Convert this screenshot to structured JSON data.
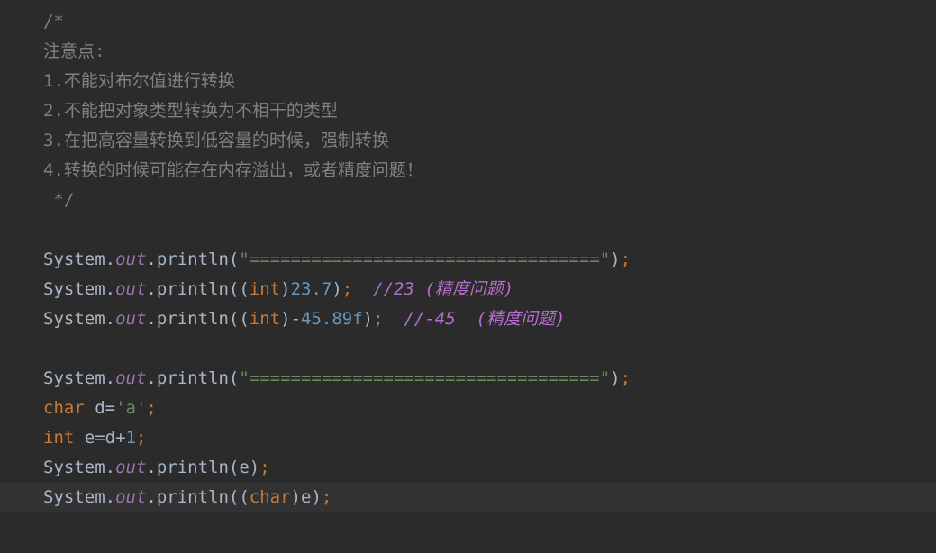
{
  "editor": {
    "language": "java",
    "colors": {
      "background": "#2b2b2b",
      "current_line": "#323232",
      "default": "#a9b7c6",
      "comment": "#808080",
      "field": "#9876aa",
      "string": "#6a8759",
      "number": "#6897bb",
      "keyword": "#cc7832",
      "italic_comment": "#b56fcf"
    },
    "current_line_index": 16,
    "lines": [
      [
        {
          "t": "/*",
          "c": "comment"
        }
      ],
      [
        {
          "t": "注意点:",
          "c": "comment"
        }
      ],
      [
        {
          "t": "1.不能对布尔值进行转换",
          "c": "comment"
        }
      ],
      [
        {
          "t": "2.不能把对象类型转换为不相干的类型",
          "c": "comment"
        }
      ],
      [
        {
          "t": "3.在把高容量转换到低容量的时候，强制转换",
          "c": "comment"
        }
      ],
      [
        {
          "t": "4.转换的时候可能存在内存溢出，或者精度问题！",
          "c": "comment"
        }
      ],
      [
        {
          "t": " */",
          "c": "comment"
        }
      ],
      [],
      [
        {
          "t": "System.",
          "c": "default"
        },
        {
          "t": "out",
          "c": "field"
        },
        {
          "t": ".println(",
          "c": "default"
        },
        {
          "t": "\"==================================\"",
          "c": "string"
        },
        {
          "t": ")",
          "c": "default"
        },
        {
          "t": ";",
          "c": "keyword"
        }
      ],
      [
        {
          "t": "System.",
          "c": "default"
        },
        {
          "t": "out",
          "c": "field"
        },
        {
          "t": ".println((",
          "c": "default"
        },
        {
          "t": "int",
          "c": "keyword"
        },
        {
          "t": ")",
          "c": "default"
        },
        {
          "t": "23.7",
          "c": "number"
        },
        {
          "t": ")",
          "c": "default"
        },
        {
          "t": ";",
          "c": "keyword"
        },
        {
          "t": "  //23 (精度问题)",
          "c": "italic_comment"
        }
      ],
      [
        {
          "t": "System.",
          "c": "default"
        },
        {
          "t": "out",
          "c": "field"
        },
        {
          "t": ".println((",
          "c": "default"
        },
        {
          "t": "int",
          "c": "keyword"
        },
        {
          "t": ")-",
          "c": "default"
        },
        {
          "t": "45.89f",
          "c": "number"
        },
        {
          "t": ")",
          "c": "default"
        },
        {
          "t": ";",
          "c": "keyword"
        },
        {
          "t": "  //-45  (精度问题)",
          "c": "italic_comment"
        }
      ],
      [],
      [
        {
          "t": "System.",
          "c": "default"
        },
        {
          "t": "out",
          "c": "field"
        },
        {
          "t": ".println(",
          "c": "default"
        },
        {
          "t": "\"==================================\"",
          "c": "string"
        },
        {
          "t": ")",
          "c": "default"
        },
        {
          "t": ";",
          "c": "keyword"
        }
      ],
      [
        {
          "t": "char",
          "c": "keyword"
        },
        {
          "t": " d=",
          "c": "default"
        },
        {
          "t": "'a'",
          "c": "string"
        },
        {
          "t": ";",
          "c": "keyword"
        }
      ],
      [
        {
          "t": "int",
          "c": "keyword"
        },
        {
          "t": " e=d+",
          "c": "default"
        },
        {
          "t": "1",
          "c": "number"
        },
        {
          "t": ";",
          "c": "keyword"
        }
      ],
      [
        {
          "t": "System.",
          "c": "default"
        },
        {
          "t": "out",
          "c": "field"
        },
        {
          "t": ".println(e)",
          "c": "default"
        },
        {
          "t": ";",
          "c": "keyword"
        }
      ],
      [
        {
          "t": "System.",
          "c": "default"
        },
        {
          "t": "out",
          "c": "field"
        },
        {
          "t": ".println((",
          "c": "default"
        },
        {
          "t": "char",
          "c": "keyword"
        },
        {
          "t": ")e)",
          "c": "default"
        },
        {
          "t": ";",
          "c": "keyword"
        }
      ]
    ]
  }
}
